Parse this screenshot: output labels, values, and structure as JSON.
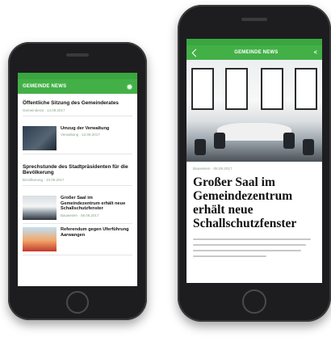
{
  "left_phone": {
    "app_title": "GEMEINDE NEWS",
    "articles": [
      {
        "title": "Öffentliche Sitzung des Gemeinderates",
        "meta": "Gemeinderat · 14.09.2017"
      },
      {
        "title": "Umzug der Verwaltung",
        "meta": "Verwaltung · 12.09.2017"
      },
      {
        "title": "Sprechstunde des Stadtpräsidenten für die Bevölkerung",
        "meta": "Bevölkerung · 10.09.2017"
      },
      {
        "title": "Großer Saal im Gemeindezentrum erhält neue Schallschutzfenster",
        "meta": "Bauwesen · 08.09.2017"
      },
      {
        "title": "Referendum gegen Uferführung Aarwangen",
        "meta": ""
      }
    ]
  },
  "right_phone": {
    "app_title": "GEMEINDE NEWS",
    "article_meta": "Bauwesen · 08.09.2017",
    "article_title": "Großer Saal im Gemeindezentrum erhält neue Schallschutzfenster"
  },
  "colors": {
    "accent": "#43b047",
    "status_bar": "#3aa640"
  },
  "icons": {
    "settings": "gear-icon",
    "back": "back-arrow-icon",
    "share": "share-icon"
  }
}
